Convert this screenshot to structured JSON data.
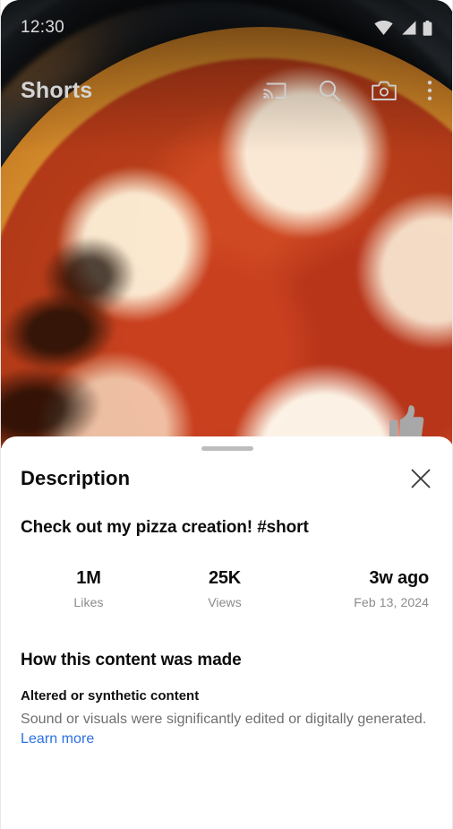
{
  "status_bar": {
    "time": "12:30",
    "icons": [
      "wifi-icon",
      "cellular-signal-icon",
      "battery-icon"
    ]
  },
  "app_bar": {
    "title": "Shorts",
    "actions": [
      {
        "name": "cast-icon",
        "label": "Cast"
      },
      {
        "name": "search-icon",
        "label": "Search"
      },
      {
        "name": "camera-icon",
        "label": "Camera"
      },
      {
        "name": "more-options-icon",
        "label": "More options"
      }
    ]
  },
  "video": {
    "like_icon": "thumbs-up-icon"
  },
  "sheet": {
    "handle": "drag-handle",
    "title": "Description",
    "close_icon": "close-icon",
    "description": "Check out my pizza creation! #short",
    "stats": [
      {
        "value": "1M",
        "label": "Likes"
      },
      {
        "value": "25K",
        "label": "Views"
      },
      {
        "value": "3w ago",
        "label": "Feb 13, 2024"
      }
    ],
    "how_made": {
      "title": "How this content was made",
      "subtitle": "Altered or synthetic content",
      "body": "Sound or visuals were significantly edited or digitally generated.",
      "link": "Learn more"
    }
  },
  "colors": {
    "link": "#2b6fe3",
    "sheet_bg": "#ffffff",
    "primary_text": "#0c0c0c",
    "secondary_text": "#6f6f6f",
    "status_text": "#dcdcdc"
  }
}
